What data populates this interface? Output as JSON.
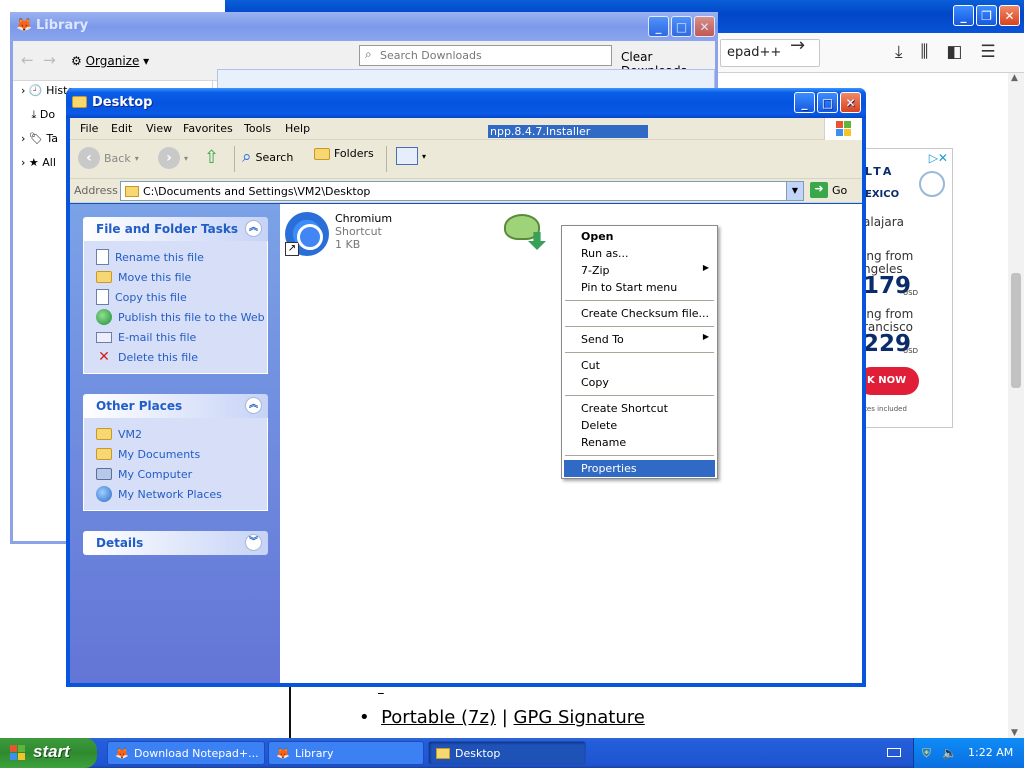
{
  "browser": {
    "url_fragment": "epad++",
    "page_links": [
      "Portable (7z)",
      "GPG Signature"
    ],
    "separator": "|",
    "ad": {
      "brand": "LTA",
      "brand_sub": "EXICO",
      "city": "alajara",
      "offer1_line1": "ing from",
      "offer1_line2": "ngeles",
      "offer1_price": "179",
      "offer2_line1": "ing from",
      "offer2_line2": "rancisco",
      "offer2_price": "229",
      "currency": "USD",
      "cta": "K NOW",
      "fine_print": "xes included"
    }
  },
  "library": {
    "title": "Library",
    "organize": "Organize",
    "search_placeholder": "Search Downloads",
    "clear_downloads": "Clear Downloads",
    "sidebar": [
      {
        "icon": "clock-icon",
        "label": "History"
      },
      {
        "icon": "download-icon",
        "label": "Do"
      },
      {
        "icon": "tag-icon",
        "label": "Ta"
      },
      {
        "icon": "star-icon",
        "label": "All"
      }
    ]
  },
  "explorer": {
    "title": "Desktop",
    "menu": [
      "File",
      "Edit",
      "View",
      "Favorites",
      "Tools",
      "Help"
    ],
    "toolbar": {
      "back": "Back",
      "search": "Search",
      "folders": "Folders"
    },
    "address_label": "Address",
    "address": "C:\\Documents and Settings\\VM2\\Desktop",
    "go": "Go",
    "file_tasks": {
      "title": "File and Folder Tasks",
      "items": [
        {
          "icon": "rename-icon",
          "label": "Rename this file"
        },
        {
          "icon": "move-icon",
          "label": "Move this file"
        },
        {
          "icon": "copy-icon",
          "label": "Copy this file"
        },
        {
          "icon": "publish-web-icon",
          "label": "Publish this file to the Web"
        },
        {
          "icon": "email-icon",
          "label": "E-mail this file"
        },
        {
          "icon": "delete-icon",
          "label": "Delete this file"
        }
      ]
    },
    "other_places": {
      "title": "Other Places",
      "items": [
        {
          "icon": "folder-icon",
          "label": "VM2"
        },
        {
          "icon": "my-documents-icon",
          "label": "My Documents"
        },
        {
          "icon": "my-computer-icon",
          "label": "My Computer"
        },
        {
          "icon": "network-places-icon",
          "label": "My Network Places"
        }
      ]
    },
    "details": {
      "title": "Details"
    },
    "files": [
      {
        "name": "Chromium",
        "type": "Shortcut",
        "size": "1 KB"
      },
      {
        "name": "npp.8.4.7.Installer"
      }
    ]
  },
  "context_menu": {
    "items": [
      {
        "label": "Open",
        "bold": true
      },
      {
        "label": "Run as..."
      },
      {
        "label": "7-Zip",
        "submenu": true
      },
      {
        "label": "Pin to Start menu"
      },
      {
        "sep": true
      },
      {
        "label": "Create Checksum file..."
      },
      {
        "sep": true
      },
      {
        "label": "Send To",
        "submenu": true
      },
      {
        "sep": true
      },
      {
        "label": "Cut"
      },
      {
        "label": "Copy"
      },
      {
        "sep": true
      },
      {
        "label": "Create Shortcut"
      },
      {
        "label": "Delete"
      },
      {
        "label": "Rename"
      },
      {
        "sep": true
      },
      {
        "label": "Properties",
        "selected": true
      }
    ]
  },
  "taskbar": {
    "start": "start",
    "tasks": [
      {
        "label": "Download Notepad+...",
        "active": false
      },
      {
        "label": "Library",
        "active": false
      },
      {
        "label": "Desktop",
        "active": true
      }
    ],
    "clock": "1:22 AM"
  }
}
